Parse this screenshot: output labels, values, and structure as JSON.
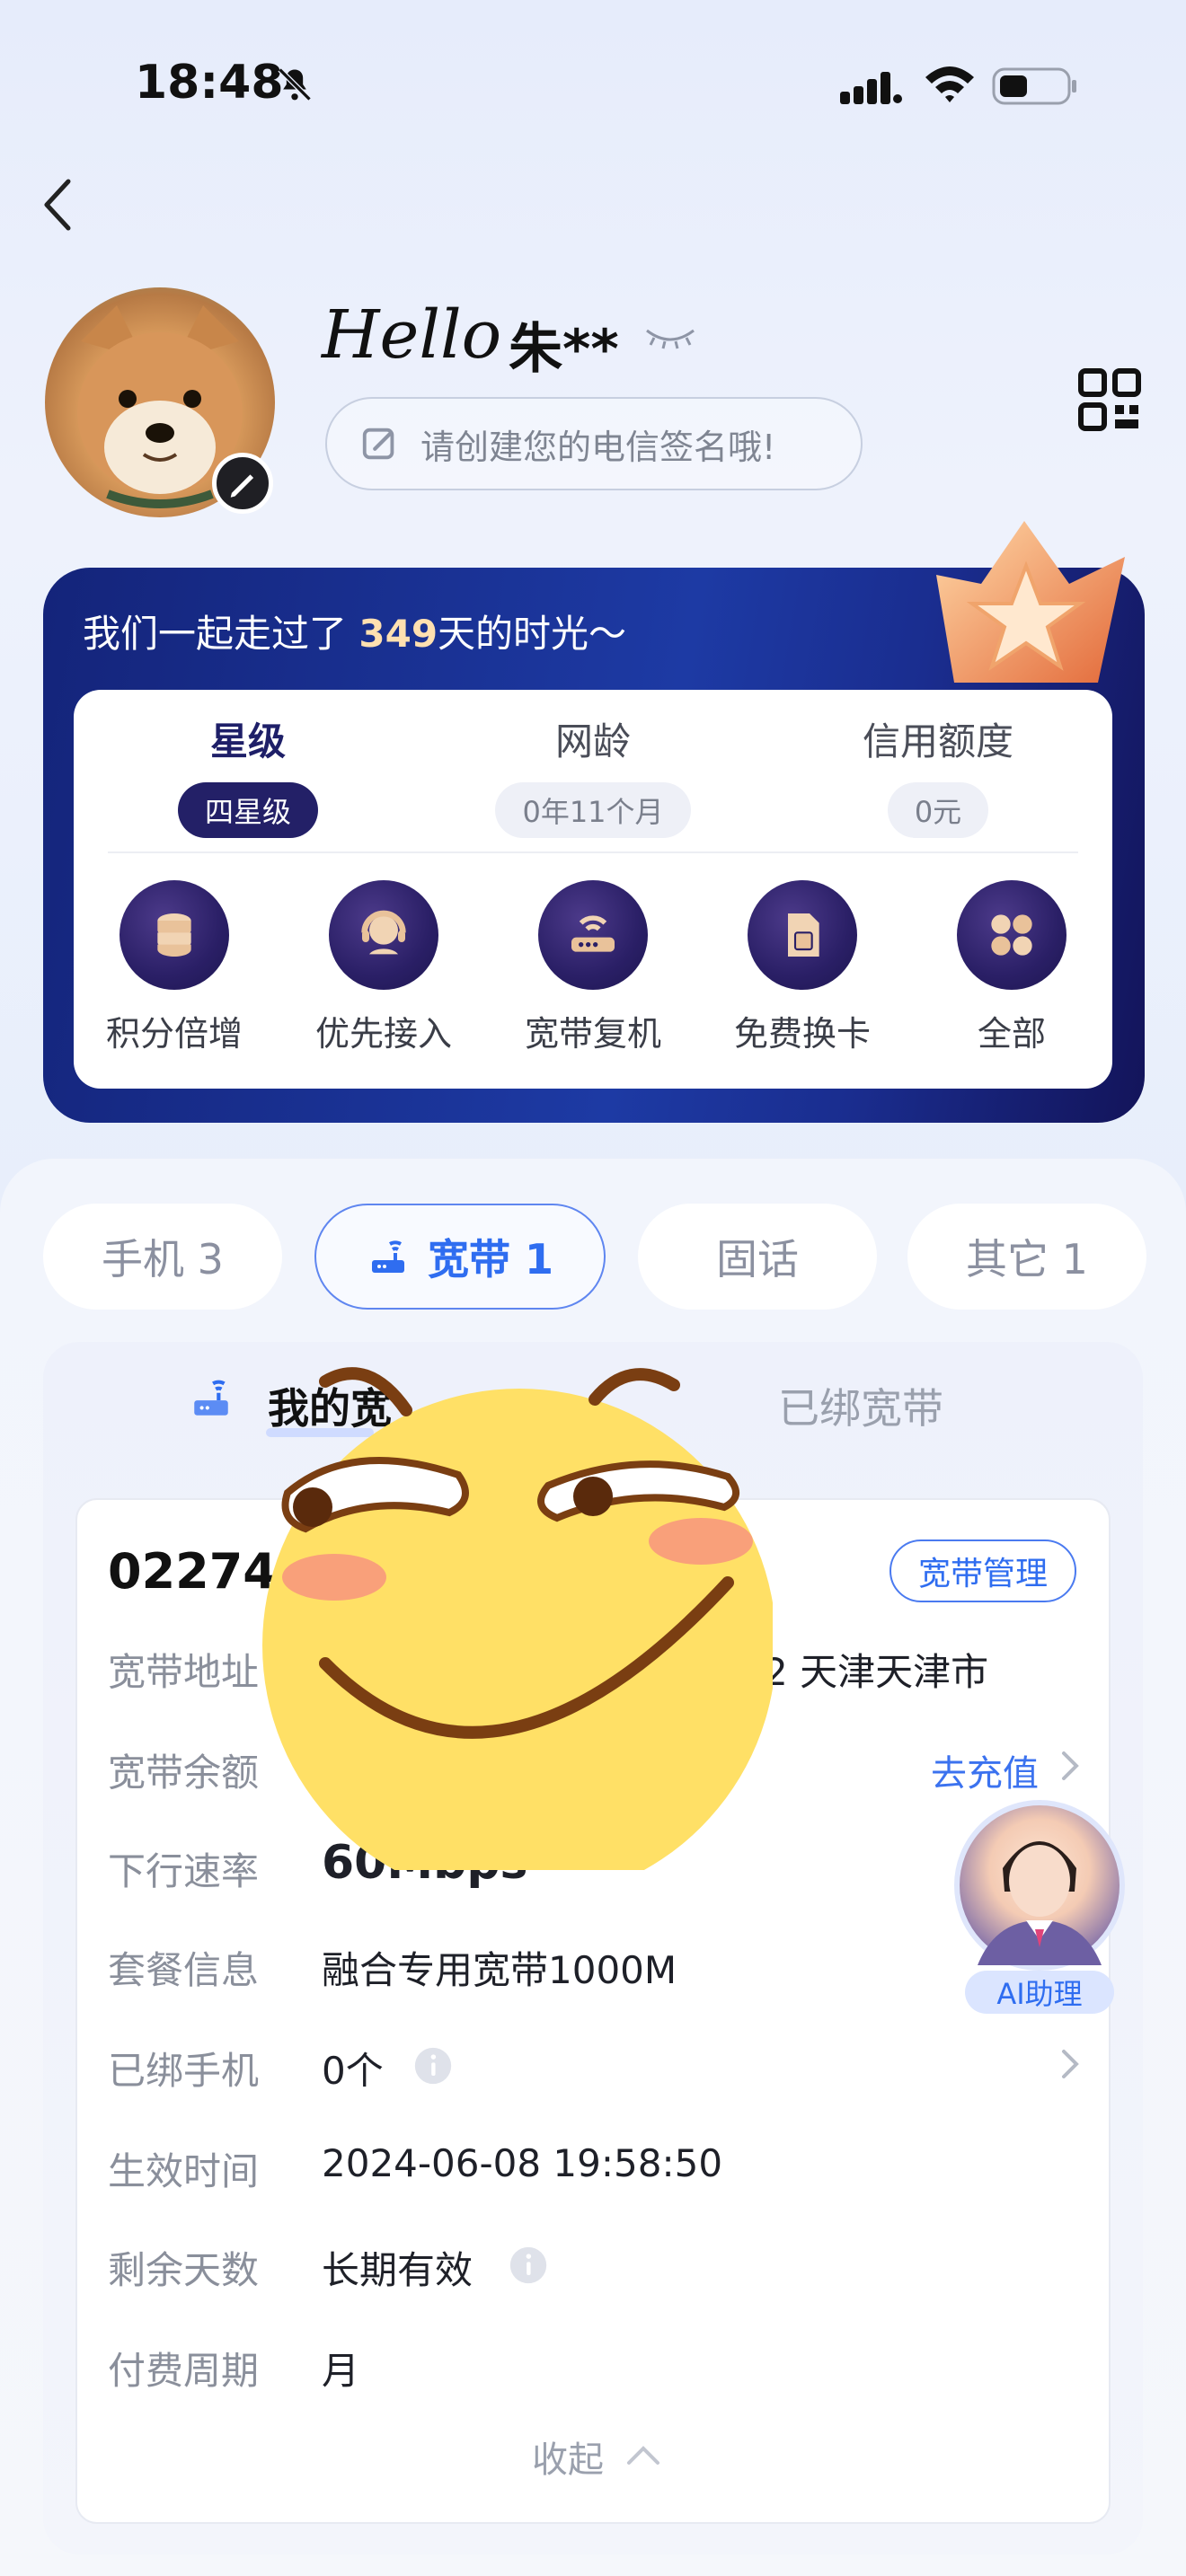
{
  "status_bar": {
    "time": "18:48",
    "icons": [
      "bell-off-icon",
      "signal-icon",
      "wifi-icon",
      "battery-icon"
    ]
  },
  "nav": {
    "back_icon": "chevron-left-icon"
  },
  "profile": {
    "greeting": "Hello",
    "name": "朱**",
    "signature_placeholder": "请创建您的电信签名哦!",
    "qr_icon": "qr-code-icon"
  },
  "membership": {
    "journey_prefix": "我们一起走过了",
    "journey_days": "349",
    "journey_suffix": "天的时光～",
    "stats": [
      {
        "title": "星级",
        "value": "四星级",
        "active": true
      },
      {
        "title": "网龄",
        "value": "0年11个月",
        "active": false
      },
      {
        "title": "信用额度",
        "value": "0元",
        "active": false
      }
    ],
    "services": [
      {
        "label": "积分倍增",
        "icon": "points-icon"
      },
      {
        "label": "优先接入",
        "icon": "headset-icon"
      },
      {
        "label": "宽带复机",
        "icon": "router-icon"
      },
      {
        "label": "免费换卡",
        "icon": "sim-card-icon"
      },
      {
        "label": "全部",
        "icon": "grid-icon"
      }
    ]
  },
  "category_tabs": [
    {
      "label": "手机 3",
      "active": false
    },
    {
      "label": "宽带 1",
      "active": true
    },
    {
      "label": "固话",
      "active": false
    },
    {
      "label": "其它 1",
      "active": false
    }
  ],
  "broadband": {
    "subtabs": {
      "mine": "我的宽",
      "bound": "已绑宽带"
    },
    "account_no": "022748",
    "manage_label": "宽带管理",
    "rows": [
      {
        "label": "宽带地址",
        "value": "",
        "tail": "2  天津天津市"
      },
      {
        "label": "宽带余额",
        "value": "",
        "action": "去充值"
      },
      {
        "label": "下行速率",
        "value": "60Mbps"
      },
      {
        "label": "套餐信息",
        "value": "融合专用宽带1000M"
      },
      {
        "label": "已绑手机",
        "value": "0个"
      },
      {
        "label": "生效时间",
        "value": "2024-06-08 19:58:50"
      },
      {
        "label": "剩余天数",
        "value": "长期有效"
      },
      {
        "label": "付费周期",
        "value": "月"
      }
    ],
    "collapse_label": "收起"
  },
  "assistant": {
    "label": "AI助理"
  },
  "colors": {
    "accent_blue": "#2f6df0",
    "card_navy": "#1d3aa4",
    "star_pill": "#232067"
  }
}
